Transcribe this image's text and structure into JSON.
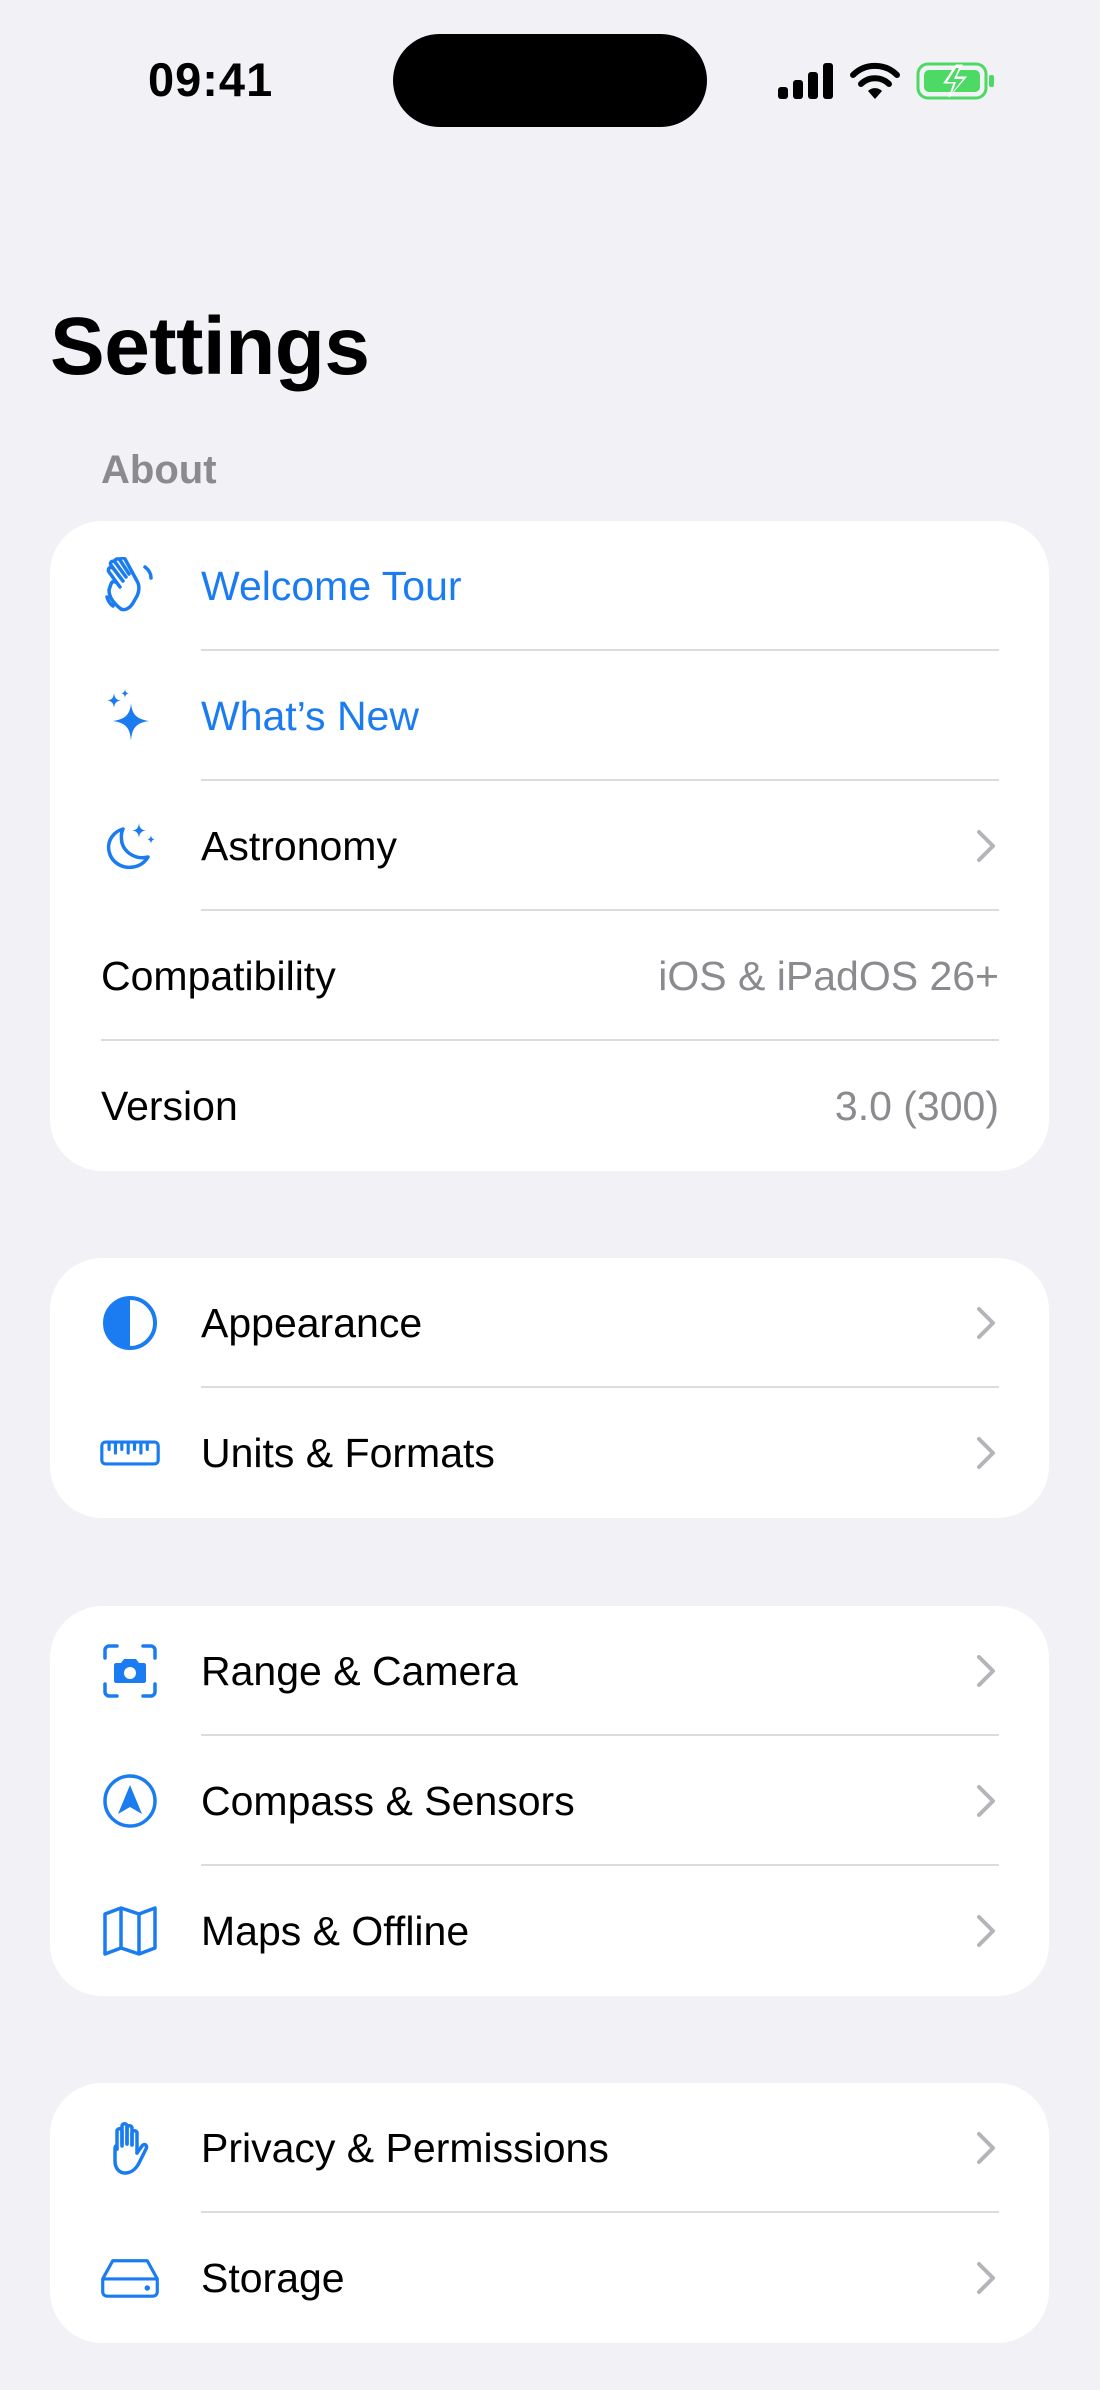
{
  "status_bar": {
    "time": "09:41"
  },
  "page": {
    "title": "Settings"
  },
  "about_section": {
    "header": "About",
    "rows": [
      {
        "label": "Welcome Tour",
        "icon": "hand-wave-icon",
        "style": "link"
      },
      {
        "label": "What’s New",
        "icon": "sparkles-icon",
        "style": "link"
      },
      {
        "label": "Astronomy",
        "icon": "moon-stars-icon",
        "style": "nav"
      },
      {
        "label": "Compatibility",
        "value": "iOS & iPadOS 26+"
      },
      {
        "label": "Version",
        "value": "3.0 (300)"
      }
    ]
  },
  "display_section": {
    "rows": [
      {
        "label": "Appearance",
        "icon": "half-circle-icon"
      },
      {
        "label": "Units & Formats",
        "icon": "ruler-icon"
      }
    ]
  },
  "features_section": {
    "rows": [
      {
        "label": "Range & Camera",
        "icon": "camera-viewfinder-icon"
      },
      {
        "label": "Compass & Sensors",
        "icon": "location-arrow-circle-icon"
      },
      {
        "label": "Maps & Offline",
        "icon": "map-icon"
      }
    ]
  },
  "system_section": {
    "rows": [
      {
        "label": "Privacy & Permissions",
        "icon": "raised-hand-icon"
      },
      {
        "label": "Storage",
        "icon": "internal-drive-icon"
      }
    ]
  },
  "colors": {
    "accent": "#1a7cf0",
    "background": "#f2f1f6",
    "secondary_text": "#8a8a8f",
    "battery": "#4cd964"
  }
}
